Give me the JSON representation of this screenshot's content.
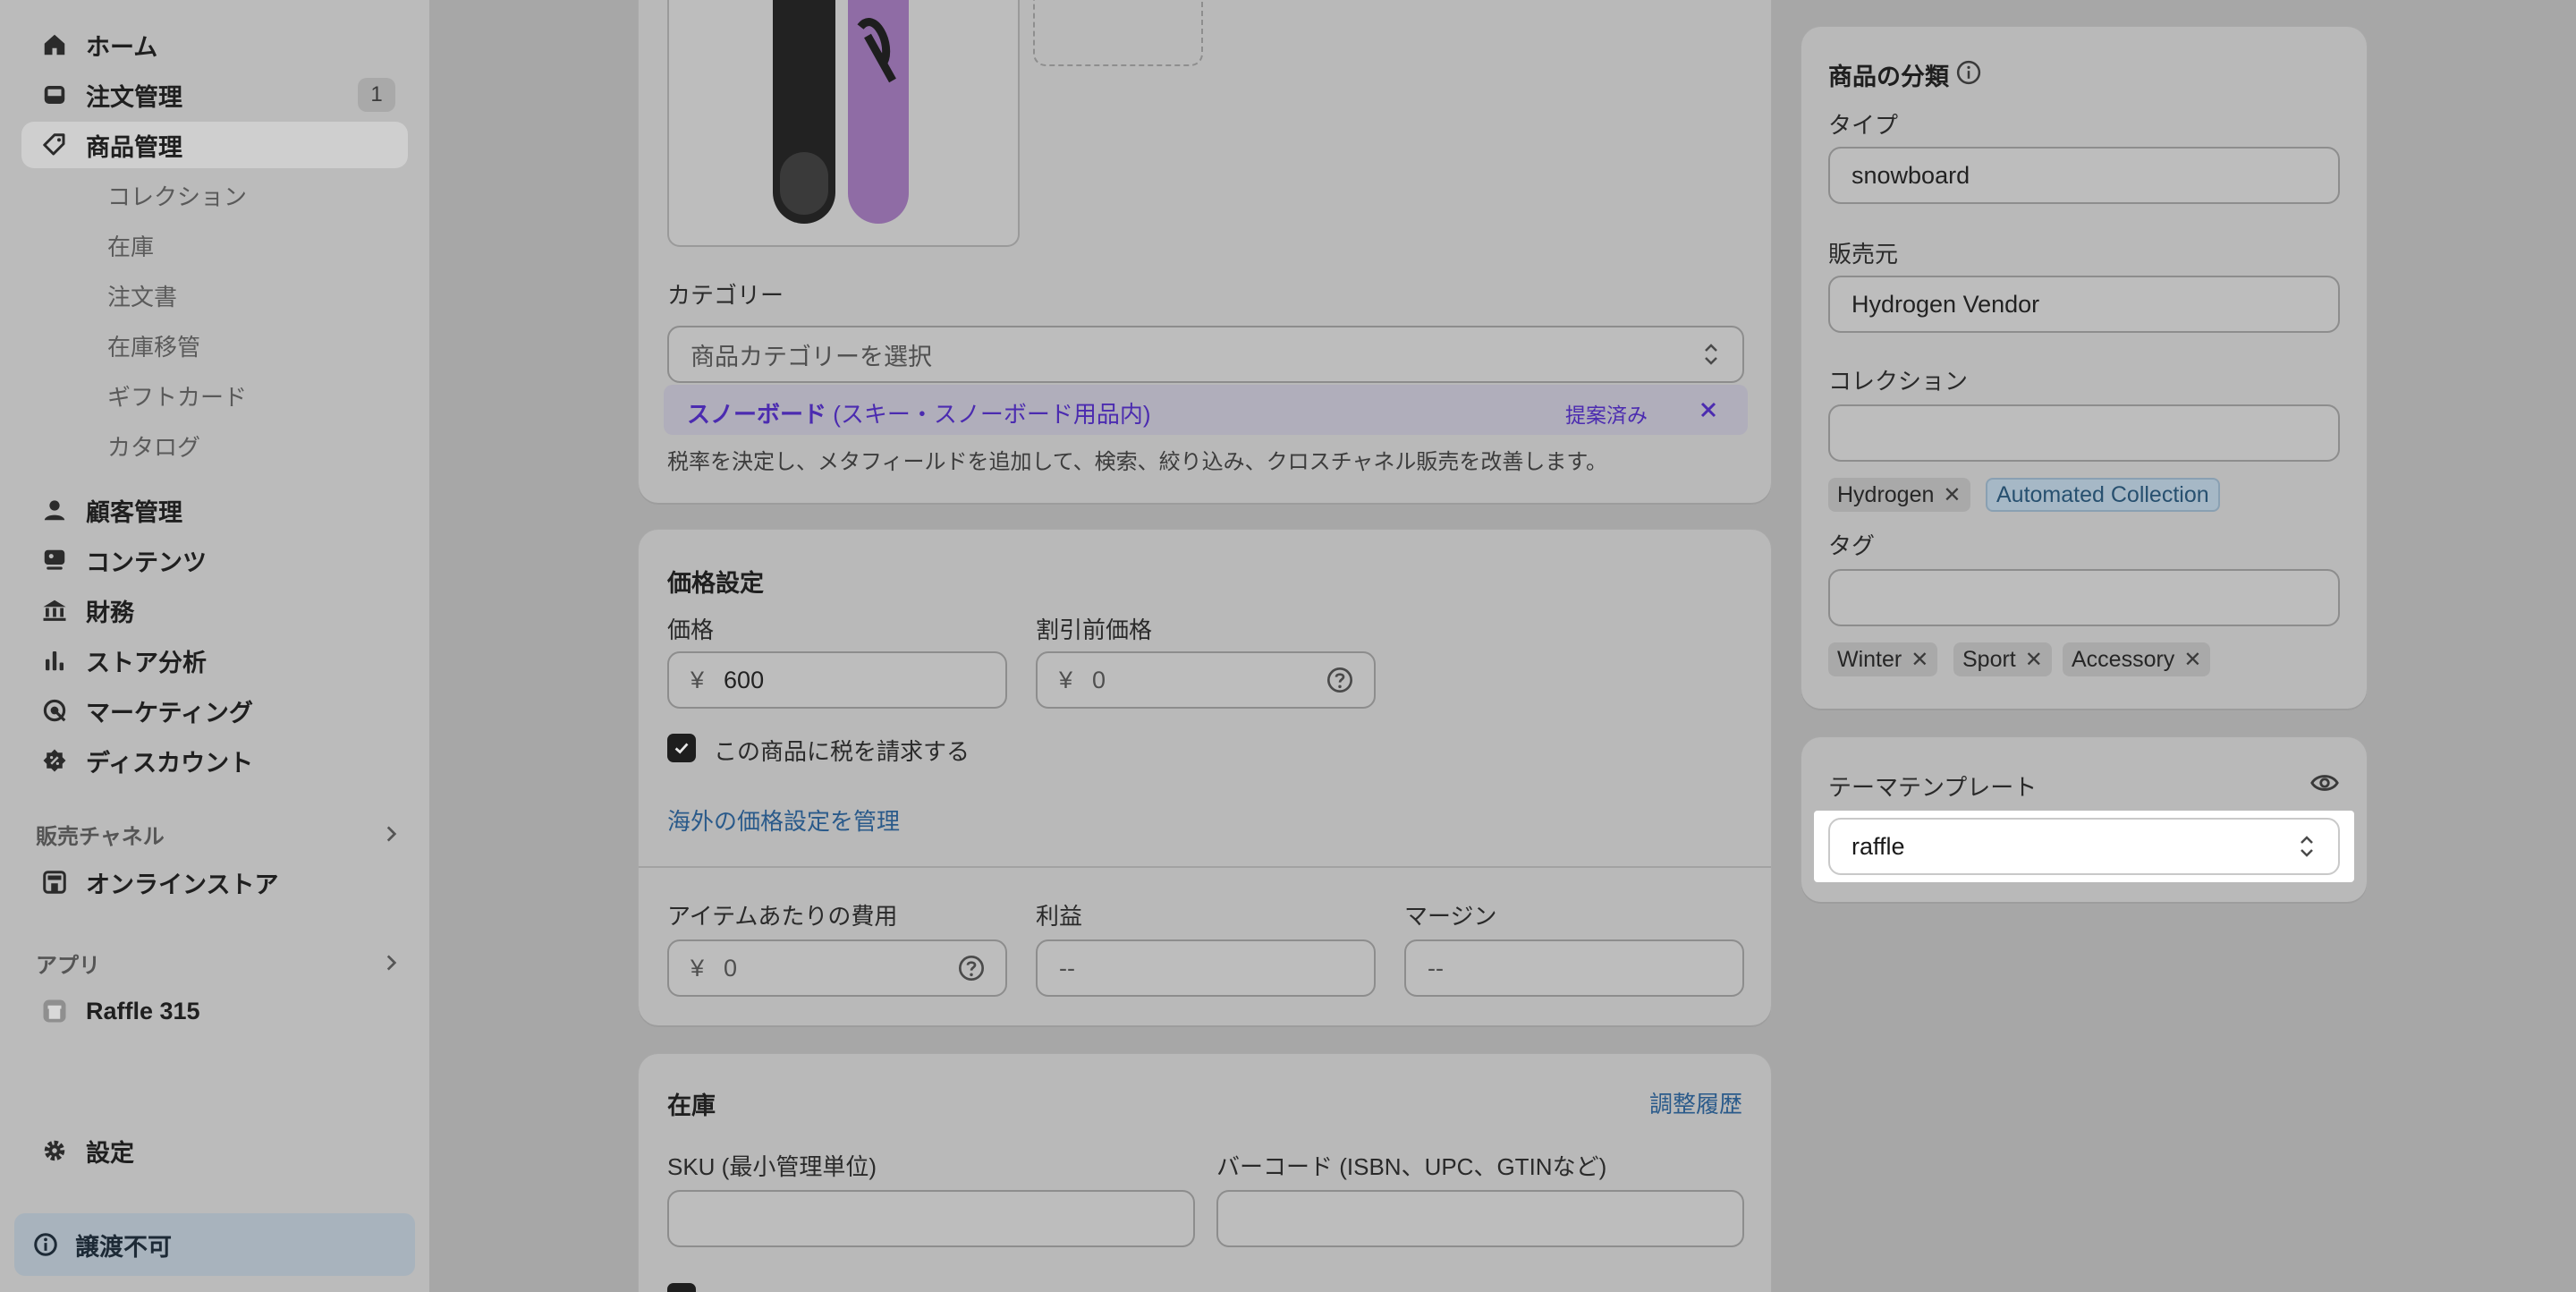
{
  "sidebar": {
    "items": [
      {
        "label": "ホーム",
        "icon": "home-icon"
      },
      {
        "label": "注文管理",
        "icon": "inbox-icon",
        "badge": "1"
      },
      {
        "label": "商品管理",
        "icon": "tag-icon",
        "active": true
      },
      {
        "label": "顧客管理",
        "icon": "person-icon"
      },
      {
        "label": "コンテンツ",
        "icon": "content-icon"
      },
      {
        "label": "財務",
        "icon": "bank-icon"
      },
      {
        "label": "ストア分析",
        "icon": "bar-chart-icon"
      },
      {
        "label": "マーケティング",
        "icon": "target-icon"
      },
      {
        "label": "ディスカウント",
        "icon": "discount-icon"
      }
    ],
    "sub_items": [
      "コレクション",
      "在庫",
      "注文書",
      "在庫移管",
      "ギフトカード",
      "カタログ"
    ],
    "sales_channels": {
      "heading": "販売チャネル",
      "items": [
        {
          "label": "オンラインストア",
          "icon": "store-icon"
        }
      ]
    },
    "apps": {
      "heading": "アプリ",
      "items": [
        {
          "label": "Raffle 315",
          "icon": "app-icon"
        }
      ]
    },
    "settings": {
      "label": "設定",
      "icon": "gear-icon"
    },
    "notice": {
      "label": "譲渡不可",
      "icon": "info-icon"
    }
  },
  "category": {
    "label": "カテゴリー",
    "placeholder": "商品カテゴリーを選択",
    "suggestion": "スノーボード",
    "suggestion_path": "(スキー・スノーボード用品内)",
    "suggestion_status": "提案済み",
    "help": "税率を決定し、メタフィールドを追加して、検索、絞り込み、クロスチャネル販売を改善します。"
  },
  "pricing": {
    "title": "価格設定",
    "price_label": "価格",
    "price_prefix": "¥",
    "price_value": "600",
    "compare_label": "割引前価格",
    "compare_prefix": "¥",
    "compare_value": "0",
    "tax_checkbox": "この商品に税を請求する",
    "tax_checked": true,
    "intl_link": "海外の価格設定を管理",
    "cost_label": "アイテムあたりの費用",
    "cost_prefix": "¥",
    "cost_value": "0",
    "profit_label": "利益",
    "profit_value": "--",
    "margin_label": "マージン",
    "margin_value": "--"
  },
  "inventory": {
    "title": "在庫",
    "history_link": "調整履歴",
    "sku_label": "SKU (最小管理単位)",
    "barcode_label": "バーコード (ISBN、UPC、GTINなど)"
  },
  "organization": {
    "title": "商品の分類",
    "type_label": "タイプ",
    "type_value": "snowboard",
    "vendor_label": "販売元",
    "vendor_value": "Hydrogen Vendor",
    "collections_label": "コレクション",
    "collections": [
      "Hydrogen",
      "Automated Collection"
    ],
    "tags_label": "タグ",
    "tags": [
      "Winter",
      "Sport",
      "Accessory"
    ]
  },
  "theme_template": {
    "label": "テーマテンプレート",
    "value": "raffle"
  },
  "colors": {
    "overlay": "#a7a7a7",
    "link": "#2a5a8a",
    "suggestion": "#4b2bb0",
    "highlight": "#ffffff"
  }
}
